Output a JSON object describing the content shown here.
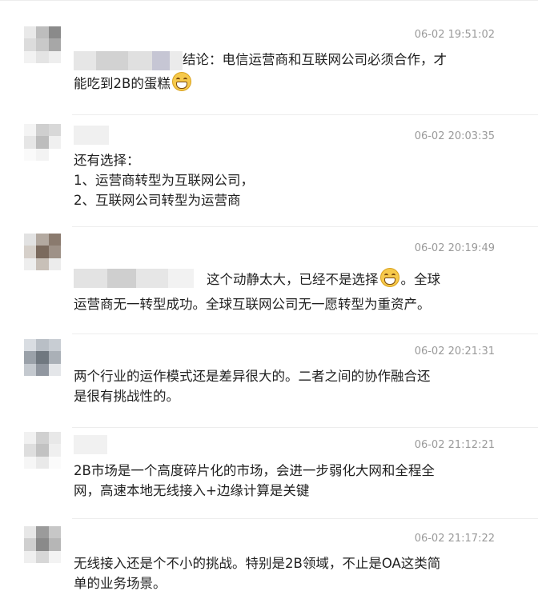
{
  "comments": [
    {
      "time": "06-02 19:51:02",
      "lines": [
        "结论：电信运营商和互联网公司必须合作，才",
        "能吃到2B的蛋糕"
      ],
      "emoji": "grin-emoji"
    },
    {
      "time": "06-02 20:03:35",
      "lines": [
        "还有选择：",
        "1、运营商转型为互联网公司，",
        "2、互联网公司转型为运营商"
      ]
    },
    {
      "time": "06-02 20:19:49",
      "lines": [
        "这个动静太大，已经不是选择",
        "。全球",
        "运营商无一转型成功。全球互联网公司无一愿转型为重资产。"
      ],
      "emoji": "grin-emoji"
    },
    {
      "time": "06-02 20:21:31",
      "lines": [
        "两个行业的运作模式还是差异很大的。二者之间的协作融合还",
        "是很有挑战性的。"
      ]
    },
    {
      "time": "06-02 21:12:21",
      "lines": [
        "2B市场是一个高度碎片化的市场，会进一步弱化大网和全程全",
        "网，高速本地无线接入+边缘计算是关键"
      ]
    },
    {
      "time": "06-02 21:17:22",
      "lines": [
        "无线接入还是个不小的挑战。特别是2B领域，不止是OA这类简",
        "单的业务场景。"
      ]
    }
  ]
}
